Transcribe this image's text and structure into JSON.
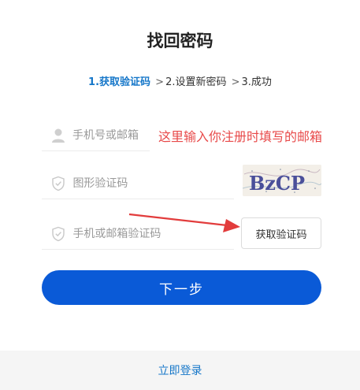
{
  "page": {
    "title": "找回密码"
  },
  "steps": {
    "step1": "1.获取验证码",
    "step2": "2.设置新密码",
    "step3": "3.成功",
    "separator": ">"
  },
  "form": {
    "account_placeholder": "手机号或邮箱",
    "captcha_placeholder": "图形验证码",
    "code_placeholder": "手机或邮箱验证码",
    "captcha_text": "BzCP",
    "get_code_label": "获取验证码",
    "next_label": "下一步"
  },
  "annotation": {
    "hint": "这里输入你注册时填写的邮箱",
    "color": "#e84a4a"
  },
  "footer": {
    "login_link": "立即登录"
  },
  "colors": {
    "primary": "#0a5ad7",
    "step_active": "#1677c9",
    "link": "#1677c9"
  },
  "icons": {
    "account": "user-icon",
    "captcha": "shield-check-icon",
    "code": "shield-check-icon"
  }
}
